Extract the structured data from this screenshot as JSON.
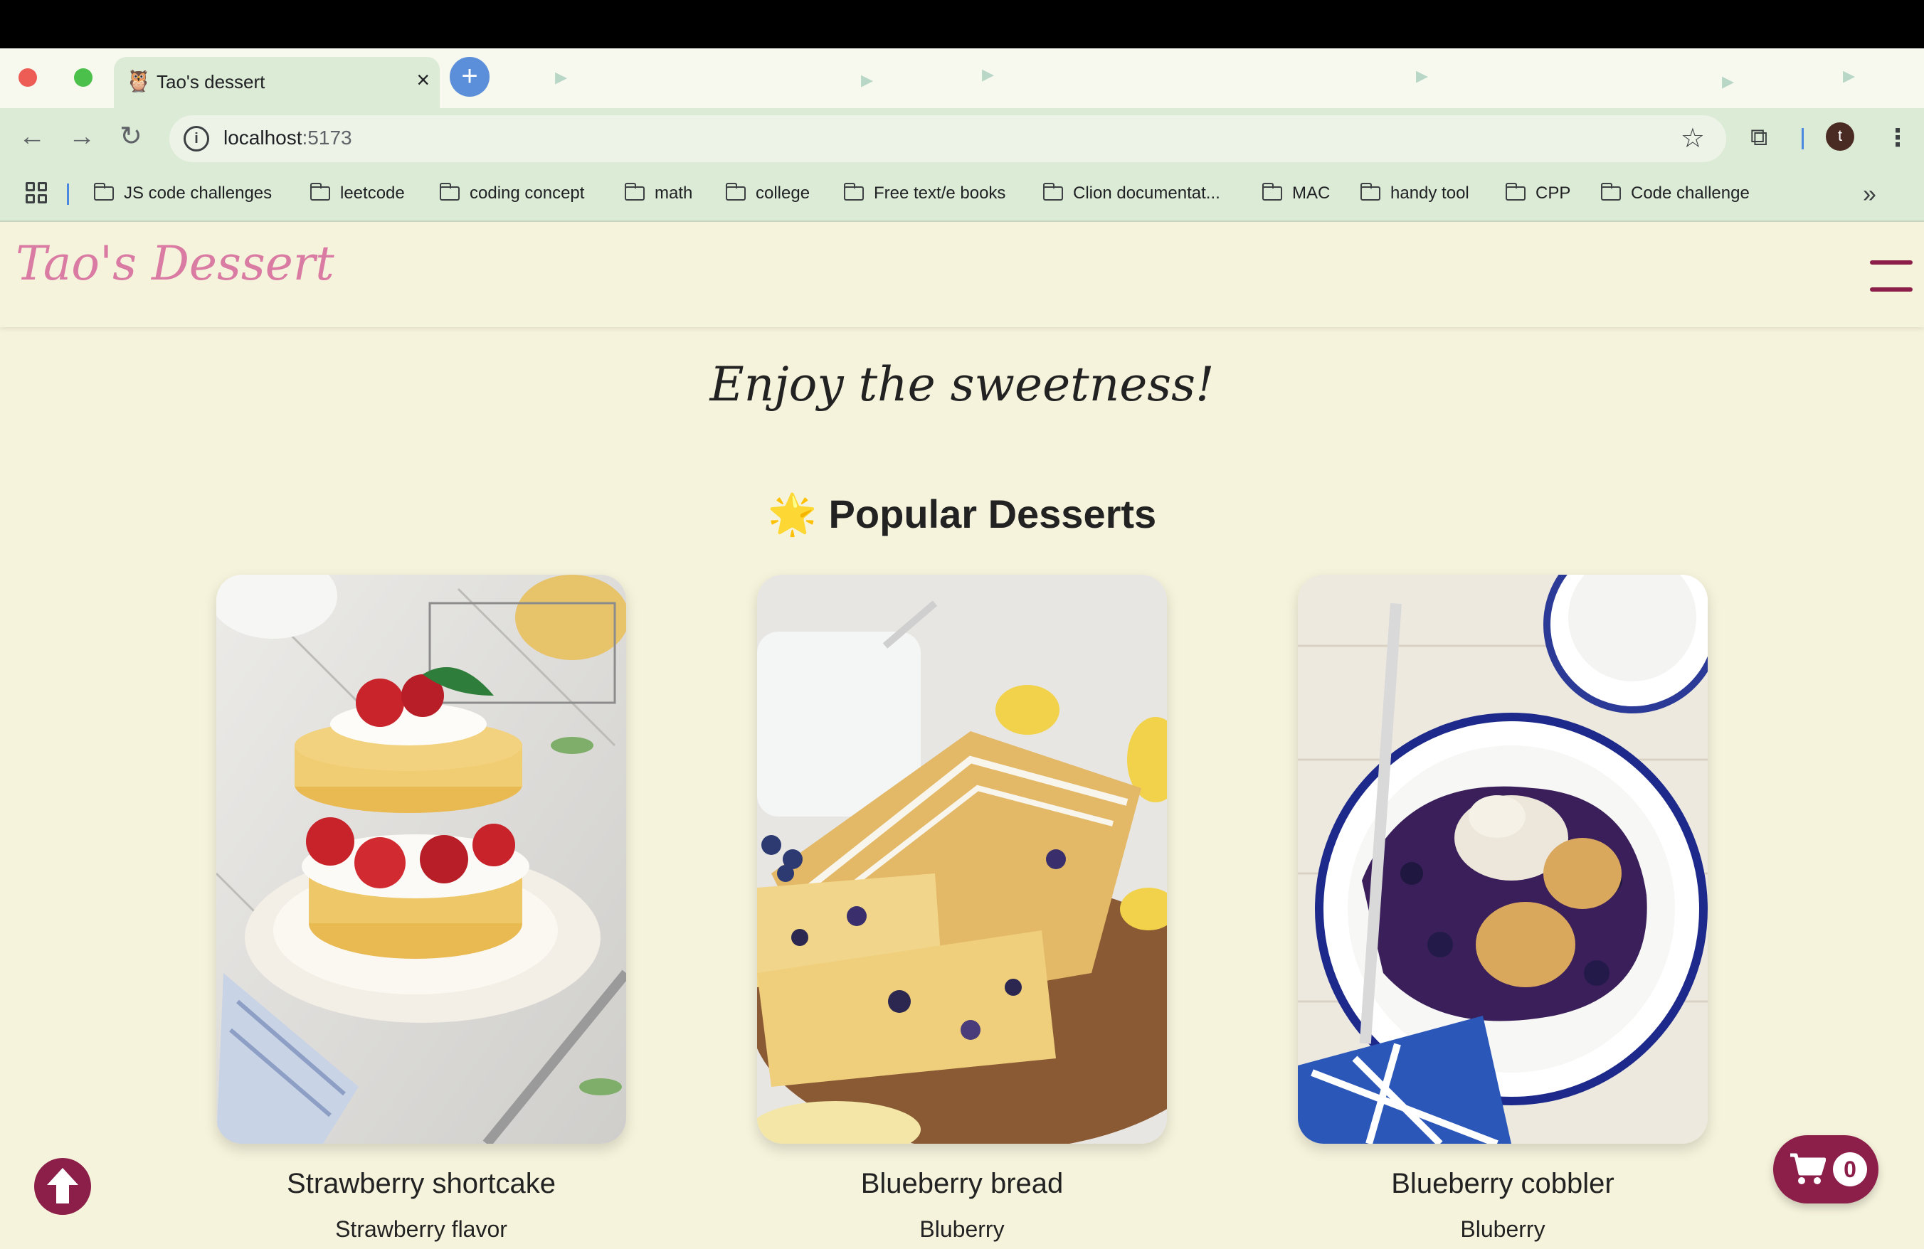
{
  "browser": {
    "tab_title": "Tao's dessert",
    "tab_favicon": "🦉",
    "tab_close": "×",
    "new_tab": "+",
    "url_host": "localhost",
    "url_port": ":5173",
    "profile_initial": "t",
    "bookmarks": [
      "JS code challenges",
      "leetcode",
      "coding concept",
      "math",
      "college",
      "Free text/e books",
      "Clion documentat...",
      "MAC",
      "handy tool",
      "CPP",
      "Code challenge"
    ],
    "more_bookmarks": "»"
  },
  "site": {
    "logo": "Tao's Dessert",
    "tagline": "Enjoy the sweetness!",
    "section_icon": "🌟",
    "section_title": "Popular Desserts",
    "products": [
      {
        "name": "Strawberry shortcake",
        "flavor": "Strawberry flavor"
      },
      {
        "name": "Blueberry bread",
        "flavor": "Bluberry"
      },
      {
        "name": "Blueberry cobbler",
        "flavor": "Bluberry"
      }
    ],
    "cart_count": "0"
  },
  "icons": [
    "apps-grid-icon",
    "back-icon",
    "forward-icon",
    "reload-icon",
    "info-icon",
    "bookmark-star-icon",
    "search-tabs-icon",
    "menu-icon",
    "hamburger-icon",
    "arrow-up-icon",
    "cart-icon"
  ],
  "colors": {
    "brand": "#8c1f4a",
    "logo": "#d97ba2",
    "page_bg": "#f6f3dc",
    "toolbar_bg": "#dcebd6"
  }
}
